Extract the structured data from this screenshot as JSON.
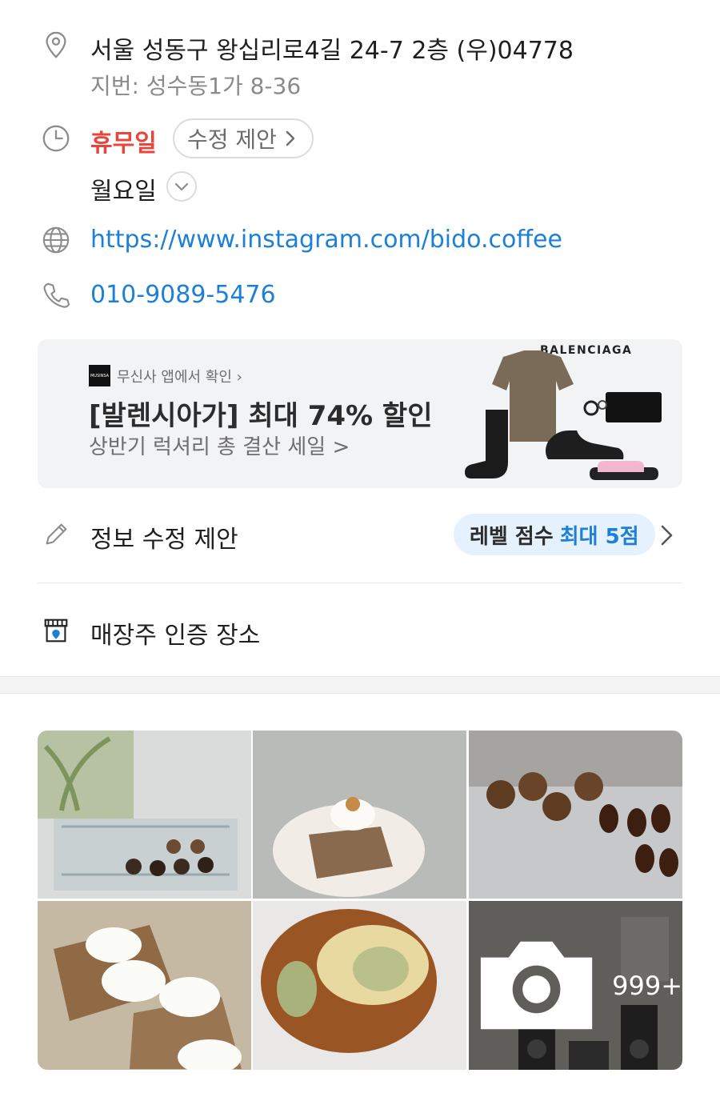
{
  "address": {
    "road": "서울 성동구 왕십리로4길 24-7 2층 (우)04778",
    "lot": "지번: 성수동1가 8-36"
  },
  "hours": {
    "status": "휴무일",
    "suggest_edit": "수정 제안",
    "day": "월요일"
  },
  "website": {
    "url": "https://www.instagram.com/bido.coffee"
  },
  "phone": {
    "number": "010-9089-5476"
  },
  "ad": {
    "logo_text": "MUSINSA",
    "source": "무신사 앱에서 확인 ›",
    "title": "[발렌시아가] 최대 74% 할인",
    "subtitle": "상반기 럭셔리 총 결산 세일 >",
    "brand": "BALENCIAGA"
  },
  "edit_info": {
    "label": "정보 수정 제안",
    "level_prefix": "레벨 점수",
    "level_value": "최대 5점"
  },
  "owner_verified": {
    "label": "매장주 인증 장소"
  },
  "photos": {
    "more_count": "999+"
  },
  "colors": {
    "link": "#1e7fd6",
    "closed": "#e8453c",
    "level_pill_bg": "#e5f1fd"
  }
}
